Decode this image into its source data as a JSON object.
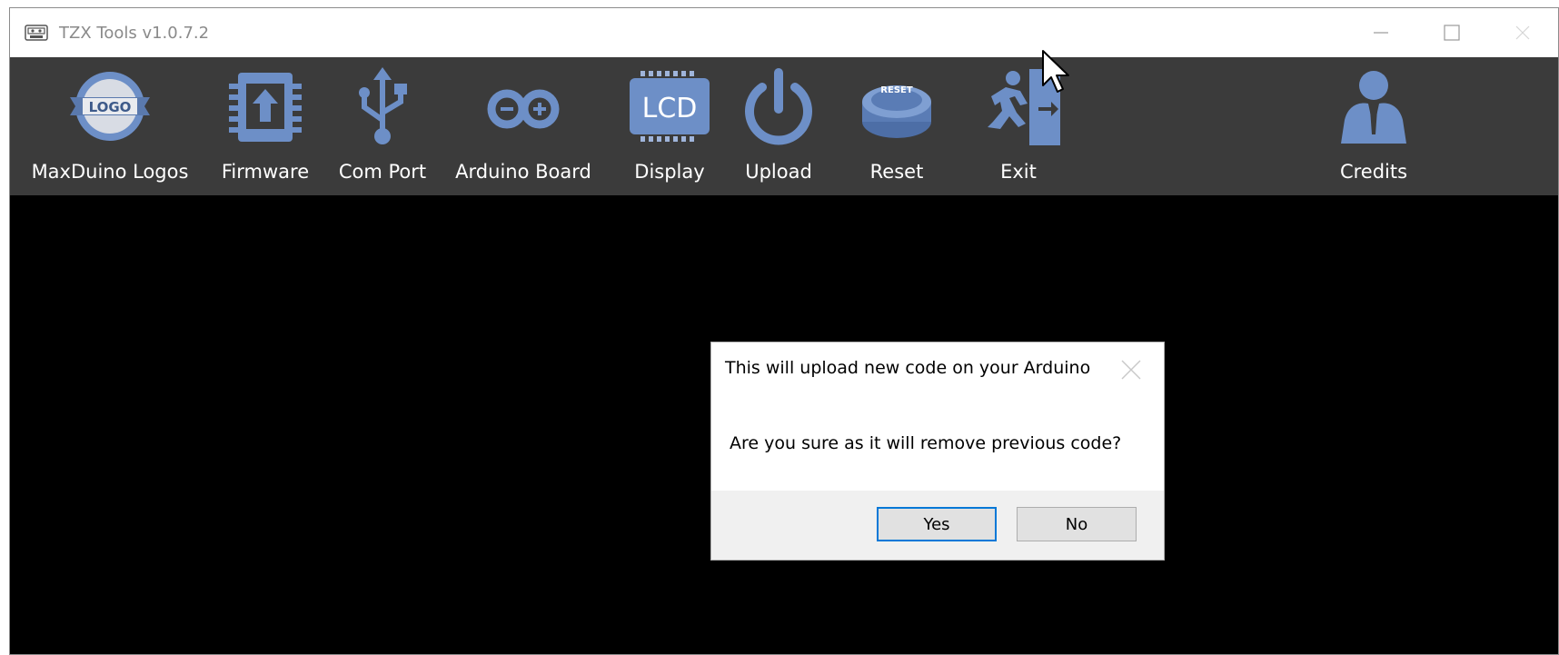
{
  "window": {
    "title": "TZX Tools v1.0.7.2",
    "controls": {
      "minimize": "minimize-icon",
      "maximize": "maximize-icon",
      "close": "close-icon"
    }
  },
  "toolbar": {
    "items": [
      {
        "label": "MaxDuino Logos",
        "icon": "logo-badge-icon"
      },
      {
        "label": "Firmware",
        "icon": "chip-upload-icon"
      },
      {
        "label": "Com Port",
        "icon": "usb-icon"
      },
      {
        "label": "Arduino Board",
        "icon": "arduino-infinity-icon"
      },
      {
        "label": "Display",
        "icon": "lcd-icon"
      },
      {
        "label": "Upload",
        "icon": "power-icon"
      },
      {
        "label": "Reset",
        "icon": "reset-button-icon"
      },
      {
        "label": "Exit",
        "icon": "exit-running-man-icon"
      },
      {
        "label": "Credits",
        "icon": "praying-person-icon"
      }
    ],
    "logo_text": "LOGO",
    "lcd_text": "LCD",
    "reset_text": "RESET"
  },
  "dialog": {
    "title": "This will upload new code on your Arduino",
    "message": "Are you sure as it will remove previous code?",
    "yes_label": "Yes",
    "no_label": "No"
  },
  "colors": {
    "toolbar_bg": "#3b3b3b",
    "icon_blue": "#6d8fc7",
    "content_bg": "#000000",
    "focus_border": "#0078d7"
  }
}
